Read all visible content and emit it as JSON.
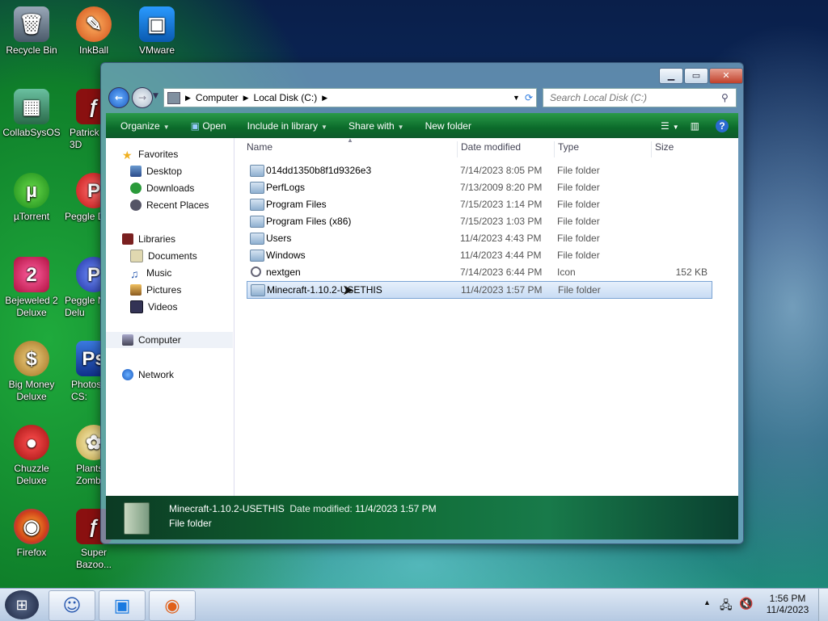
{
  "desktop": {
    "icons": [
      {
        "label": "Recycle Bin",
        "color": "#607080"
      },
      {
        "label": "InkBall",
        "color": "#e86a1a"
      },
      {
        "label": "VMware",
        "color": "#1a7ae0"
      },
      {
        "label": "CollabSysOS",
        "color": "#3a9a6a"
      },
      {
        "label": "Patrick\n3D",
        "color": "#8a1010"
      },
      {
        "label": "µTorrent",
        "color": "#2a9a2a"
      },
      {
        "label": "Peggle D",
        "color": "#d03030"
      },
      {
        "label": "Bejeweled 2\nDeluxe",
        "color": "#d02050"
      },
      {
        "label": "Peggle N\nDelu",
        "color": "#3050c0"
      },
      {
        "label": "Big Money\nDeluxe",
        "color": "#b08020"
      },
      {
        "label": "Photos\nCS:",
        "color": "#1a4ab0"
      },
      {
        "label": "Chuzzle\nDeluxe",
        "color": "#c02020"
      },
      {
        "label": "Plants\nZomb",
        "color": "#e0d080"
      },
      {
        "label": "Firefox",
        "color": "#e0601a"
      },
      {
        "label": "Super\nBazoo...",
        "color": "#8a1010"
      }
    ]
  },
  "window": {
    "address": {
      "part1": "Computer",
      "part2": "Local Disk (C:)"
    },
    "search_placeholder": "Search Local Disk (C:)",
    "toolbar": {
      "organize": "Organize",
      "open": "Open",
      "include": "Include in library",
      "share": "Share with",
      "newfolder": "New folder"
    },
    "nav": {
      "favorites": "Favorites",
      "desktop": "Desktop",
      "downloads": "Downloads",
      "recent": "Recent Places",
      "libraries": "Libraries",
      "documents": "Documents",
      "music": "Music",
      "pictures": "Pictures",
      "videos": "Videos",
      "computer": "Computer",
      "network": "Network"
    },
    "columns": {
      "name": "Name",
      "date": "Date modified",
      "type": "Type",
      "size": "Size"
    },
    "files": [
      {
        "name": "014dd1350b8f1d9326e3",
        "date": "7/14/2023 8:05 PM",
        "type": "File folder",
        "size": ""
      },
      {
        "name": "PerfLogs",
        "date": "7/13/2009 8:20 PM",
        "type": "File folder",
        "size": ""
      },
      {
        "name": "Program Files",
        "date": "7/15/2023 1:14 PM",
        "type": "File folder",
        "size": ""
      },
      {
        "name": "Program Files (x86)",
        "date": "7/15/2023 1:03 PM",
        "type": "File folder",
        "size": ""
      },
      {
        "name": "Users",
        "date": "11/4/2023 4:43 PM",
        "type": "File folder",
        "size": ""
      },
      {
        "name": "Windows",
        "date": "11/4/2023 4:44 PM",
        "type": "File folder",
        "size": ""
      },
      {
        "name": "nextgen",
        "date": "7/14/2023 6:44 PM",
        "type": "Icon",
        "size": "152 KB"
      },
      {
        "name": "Minecraft-1.10.2-USETHIS",
        "date": "11/4/2023 1:57 PM",
        "type": "File folder",
        "size": ""
      }
    ],
    "status": {
      "name": "Minecraft-1.10.2-USETHIS",
      "modified_label": "Date modified:",
      "modified_value": "11/4/2023 1:57 PM",
      "type": "File folder"
    }
  },
  "taskbar": {
    "time": "1:56 PM",
    "date": "11/4/2023"
  }
}
